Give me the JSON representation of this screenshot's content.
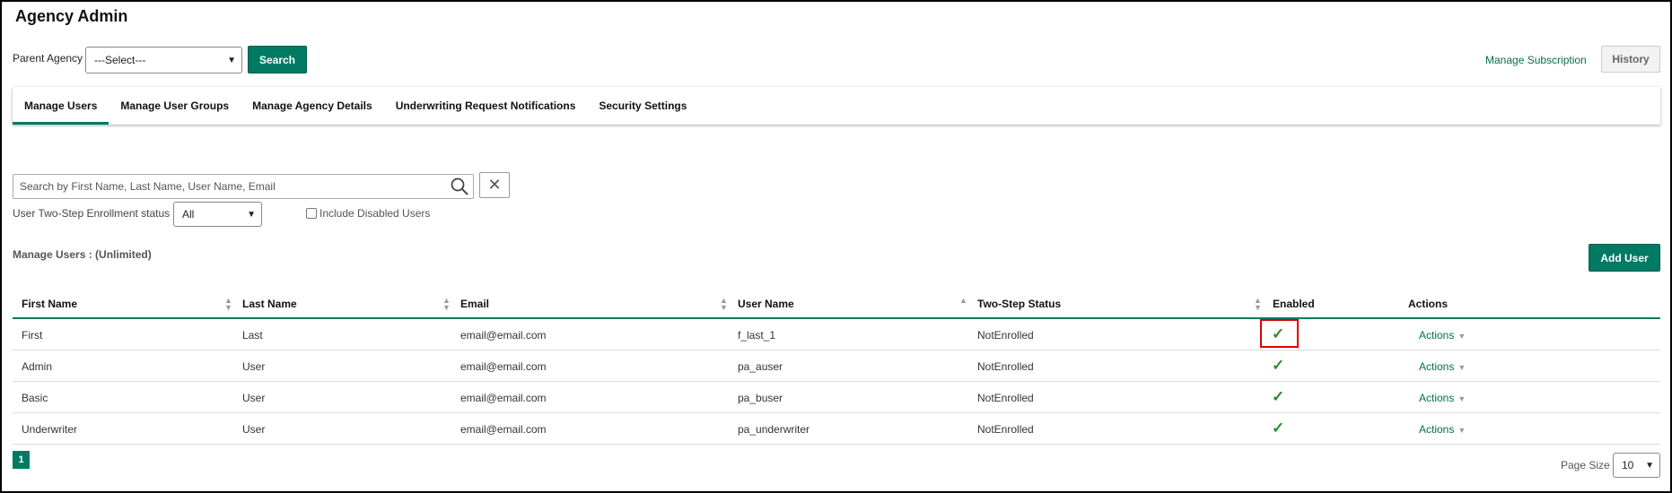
{
  "page": {
    "title": "Agency Admin"
  },
  "filter": {
    "parent_agency_label": "Parent Agency",
    "parent_agency_value": "---Select---",
    "search_label": "Search"
  },
  "header_links": {
    "manage_subscription": "Manage Subscription",
    "history": "History"
  },
  "tabs": [
    {
      "label": "Manage Users",
      "active": true
    },
    {
      "label": "Manage User Groups",
      "active": false
    },
    {
      "label": "Manage Agency Details",
      "active": false
    },
    {
      "label": "Underwriting Request Notifications",
      "active": false
    },
    {
      "label": "Security Settings",
      "active": false
    }
  ],
  "user_search": {
    "placeholder": "Search by First Name, Last Name, User Name, Email",
    "enrollment_label": "User Two-Step Enrollment status",
    "enrollment_value": "All",
    "include_disabled_label": "Include Disabled Users",
    "include_disabled_checked": false
  },
  "manage_users_label": "Manage Users : (Unlimited)",
  "add_user_label": "Add User",
  "table": {
    "columns": [
      "First Name",
      "Last Name",
      "Email",
      "User Name",
      "Two-Step Status",
      "Enabled",
      "Actions"
    ],
    "sorted_column": "User Name",
    "sort_direction": "ascending",
    "rows": [
      {
        "first": "First",
        "last": "Last",
        "email": "email@email.com",
        "username": "f_last_1",
        "status": "NotEnrolled",
        "enabled": true,
        "action": "Actions"
      },
      {
        "first": "Admin",
        "last": "User",
        "email": "email@email.com",
        "username": "pa_auser",
        "status": "NotEnrolled",
        "enabled": true,
        "action": "Actions"
      },
      {
        "first": "Basic",
        "last": "User",
        "email": "email@email.com",
        "username": "pa_buser",
        "status": "NotEnrolled",
        "enabled": true,
        "action": "Actions"
      },
      {
        "first": "Underwriter",
        "last": "User",
        "email": "email@email.com",
        "username": "pa_underwriter",
        "status": "NotEnrolled",
        "enabled": true,
        "action": "Actions"
      }
    ]
  },
  "pagination": {
    "current_page": "1",
    "page_size_label": "Page Size",
    "page_size_value": "10"
  },
  "icons": {
    "search": "magnifier-icon",
    "clear": "close-icon",
    "check": "check-icon",
    "dropdown": "chevron-down-icon"
  },
  "colors": {
    "accent": "#007a63",
    "link": "#00704f",
    "check": "#2e8b2e",
    "highlight": "#e00000"
  }
}
